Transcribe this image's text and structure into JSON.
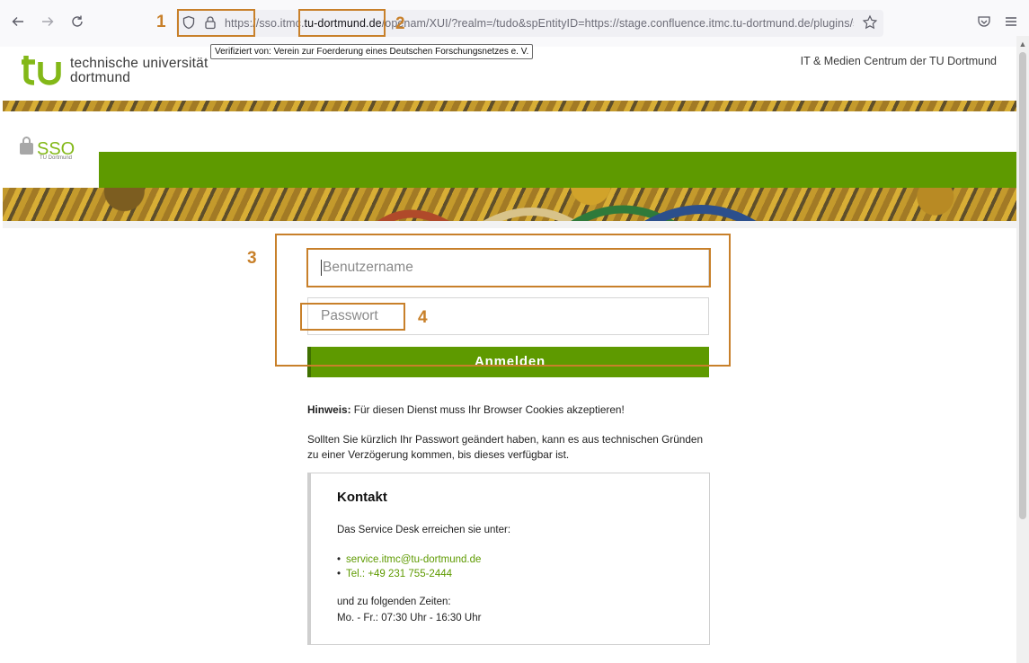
{
  "browser": {
    "url_prefix": "https://sso.itmc.",
    "url_host": "tu-dortmund.de",
    "url_suffix": "/openam/XUI/?realm=/tudo&spEntityID=https://stage.confluence.itmc.tu-dortmund.de/plugins/s",
    "cert_tooltip": "Verifiziert von: Verein zur Foerderung eines Deutschen Forschungsnetzes e. V.",
    "icons": [
      "back-icon",
      "forward-icon",
      "reload-icon",
      "shield-icon",
      "lock-icon",
      "bookmark-star-icon",
      "pocket-icon",
      "menu-icon"
    ]
  },
  "header": {
    "logo_text_line1": "technische universität",
    "logo_text_line2": "dortmund",
    "right_title": "IT & Medien Centrum der TU Dortmund"
  },
  "banner": {
    "sso_text": "SSO",
    "sso_subtext": "TU Dortmund"
  },
  "login": {
    "username_placeholder": "Benutzername",
    "password_placeholder": "Passwort",
    "submit_label": "Anmelden"
  },
  "info": {
    "hint_label": "Hinweis:",
    "hint_text": " Für diesen Dienst muss Ihr Browser Cookies akzeptieren!",
    "password_note": "Sollten Sie kürzlich Ihr Passwort geändert haben, kann es aus technischen Gründen zu einer Verzögerung kommen, bis dieses verfügbar ist."
  },
  "contact": {
    "title": "Kontakt",
    "intro": "Das Service Desk erreichen sie unter:",
    "links": [
      "service.itmc@tu-dortmund.de",
      "Tel.: +49 231 755-2444"
    ],
    "hours_label": "und zu folgenden Zeiten:",
    "hours": "Mo. - Fr.: 07:30 Uhr - 16:30 Uhr"
  },
  "annotations": [
    "1",
    "2",
    "3",
    "4"
  ],
  "colors": {
    "tu_green": "#5e9a00",
    "annotation_orange": "#c8802a"
  }
}
